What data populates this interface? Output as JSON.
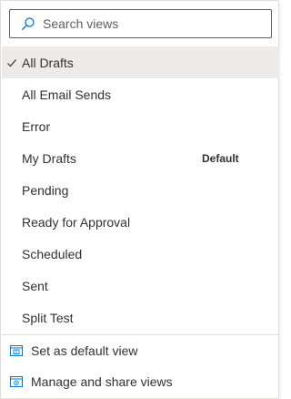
{
  "search": {
    "placeholder": "Search views",
    "icon": "search-icon"
  },
  "views": [
    {
      "label": "All Drafts",
      "selected": true,
      "badge": ""
    },
    {
      "label": "All Email Sends",
      "selected": false,
      "badge": ""
    },
    {
      "label": "Error",
      "selected": false,
      "badge": ""
    },
    {
      "label": "My Drafts",
      "selected": false,
      "badge": "Default"
    },
    {
      "label": "Pending",
      "selected": false,
      "badge": ""
    },
    {
      "label": "Ready for Approval",
      "selected": false,
      "badge": ""
    },
    {
      "label": "Scheduled",
      "selected": false,
      "badge": ""
    },
    {
      "label": "Sent",
      "selected": false,
      "badge": ""
    },
    {
      "label": "Split Test",
      "selected": false,
      "badge": ""
    }
  ],
  "actions": [
    {
      "label": "Set as default view",
      "icon": "set-default-view-icon"
    },
    {
      "label": "Manage and share views",
      "icon": "manage-views-icon"
    }
  ],
  "colors": {
    "accent": "#0078d4",
    "selected_bg": "#edebe9",
    "text": "#323130",
    "border": "#605e5c"
  }
}
